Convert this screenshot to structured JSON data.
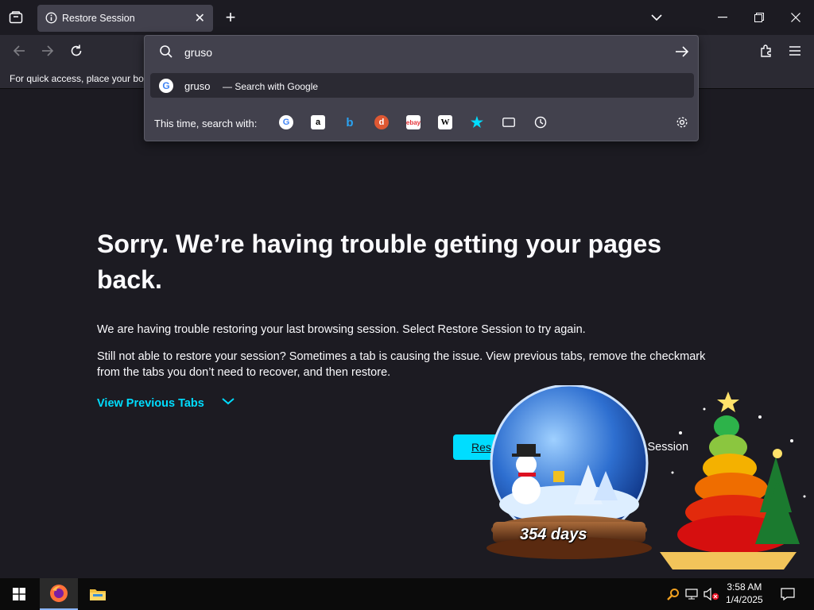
{
  "tabs": [
    {
      "title": "Restore Session",
      "active": true
    }
  ],
  "bookmarks": {
    "hint": "For quick access, place your boo"
  },
  "urlbar": {
    "value": "gruso",
    "suggestion_term": "gruso",
    "suggestion_action": "— Search with Google",
    "one_off_label": "This time, search with:",
    "engines": [
      "Google",
      "Amazon",
      "Bing",
      "DuckDuckGo",
      "eBay",
      "Wikipedia",
      "Bookmarks",
      "Tabs",
      "History"
    ]
  },
  "page": {
    "heading": "Sorry. We’re having trouble getting your pages back.",
    "para1": "We are having trouble restoring your last browsing session. Select Restore Session to try again.",
    "para2": "Still not able to restore your session? Sometimes a tab is causing the issue. View previous tabs, remove the checkmark from the tabs you don’t need to recover, and then restore.",
    "view_previous": "View Previous Tabs",
    "restore_button": "Res",
    "new_session": "w Session"
  },
  "widgets": {
    "countdown": "354 days"
  },
  "taskbar": {
    "time": "3:58 AM",
    "date": "1/4/2025"
  },
  "colors": {
    "accent": "#00ddff",
    "bg": "#1c1b22",
    "toolbar": "#2b2a33",
    "popup": "#42414d"
  }
}
